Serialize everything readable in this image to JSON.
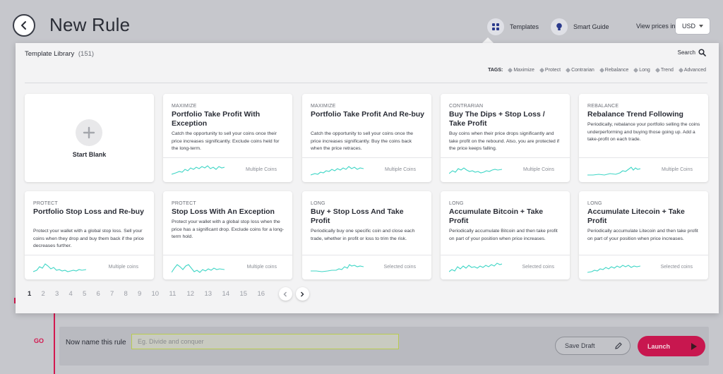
{
  "header": {
    "title": "New Rule",
    "templates_label": "Templates",
    "smart_guide_label": "Smart Guide",
    "prices_label": "View prices in:",
    "currency": "USD"
  },
  "library": {
    "title": "Template Library",
    "count": "(151)",
    "search_label": "Search",
    "tags_label": "TAGS:",
    "tags": [
      "Maximize",
      "Protect",
      "Contrarian",
      "Rebalance",
      "Long",
      "Trend",
      "Advanced"
    ],
    "blank_label": "Start Blank",
    "cards": [
      {
        "tag": "MAXIMIZE",
        "title": "Portfolio Take Profit With Exception",
        "desc": "Catch the opportunity to sell your coins once their price increases significantly. Exclude coins held for the long-term.",
        "coins": "Multiple Coins"
      },
      {
        "tag": "MAXIMIZE",
        "title": "Portfolio Take Profit And Re-buy",
        "desc": "Catch the opportunity to sell your coins once the price increases significantly. Buy the coins back when the price retraces.",
        "coins": "Multiple Coins"
      },
      {
        "tag": "CONTRARIAN",
        "title": "Buy The Dips + Stop Loss / Take Profit",
        "desc": "Buy coins when their price drops significantly and take profit on the rebound. Also, you are protected if the price keeps falling.",
        "coins": "Multiple Coins"
      },
      {
        "tag": "REBALANCE",
        "title": "Rebalance Trend Following",
        "desc": "Periodically, rebalance your portfolio selling the coins underperforming and buying those going up. Add a take-profit on each trade.",
        "coins": "Multiple Coins"
      },
      {
        "tag": "PROTECT",
        "title": "Portfolio Stop Loss and Re-buy",
        "desc": "Protect your wallet with a global stop loss. Sell your coins when they drop and buy them back if the price decreases further.",
        "coins": "Multiple coins"
      },
      {
        "tag": "PROTECT",
        "title": "Stop Loss With An Exception",
        "desc": "Protect your wallet with a global stop loss when the price has a significant drop. Exclude coins for a long-term hold.",
        "coins": "Multiple coins"
      },
      {
        "tag": "LONG",
        "title": "Buy + Stop Loss And Take Profit",
        "desc": "Periodically buy one specific coin and close each trade, whether in profit or loss to trim the risk.",
        "coins": "Selected coins"
      },
      {
        "tag": "LONG",
        "title": "Accumulate Bitcoin + Take Profit",
        "desc": "Periodically accumulate Bitcoin and then take profit on part of your position when price increases.",
        "coins": "Selected coins"
      },
      {
        "tag": "LONG",
        "title": "Accumulate Litecoin + Take Profit",
        "desc": "Periodically accumulate Litecoin and then take profit on part of your position when price increases.",
        "coins": "Selected coins"
      }
    ],
    "pages": [
      "1",
      "2",
      "3",
      "4",
      "5",
      "6",
      "7",
      "8",
      "9",
      "10",
      "11",
      "12",
      "13",
      "14",
      "15",
      "16"
    ],
    "current_page": "1"
  },
  "rule": {
    "step_label": "GO",
    "name_label": "Now name this rule",
    "name_placeholder": "Eg. Divide and conquer",
    "name_value": "",
    "save_draft_label": "Save Draft",
    "launch_label": "Launch"
  },
  "colors": {
    "accent": "#c8174f",
    "sparkline": "#3fd6c6",
    "panel_bg": "#f3f3f4",
    "backdrop": "#c6c7cc"
  }
}
